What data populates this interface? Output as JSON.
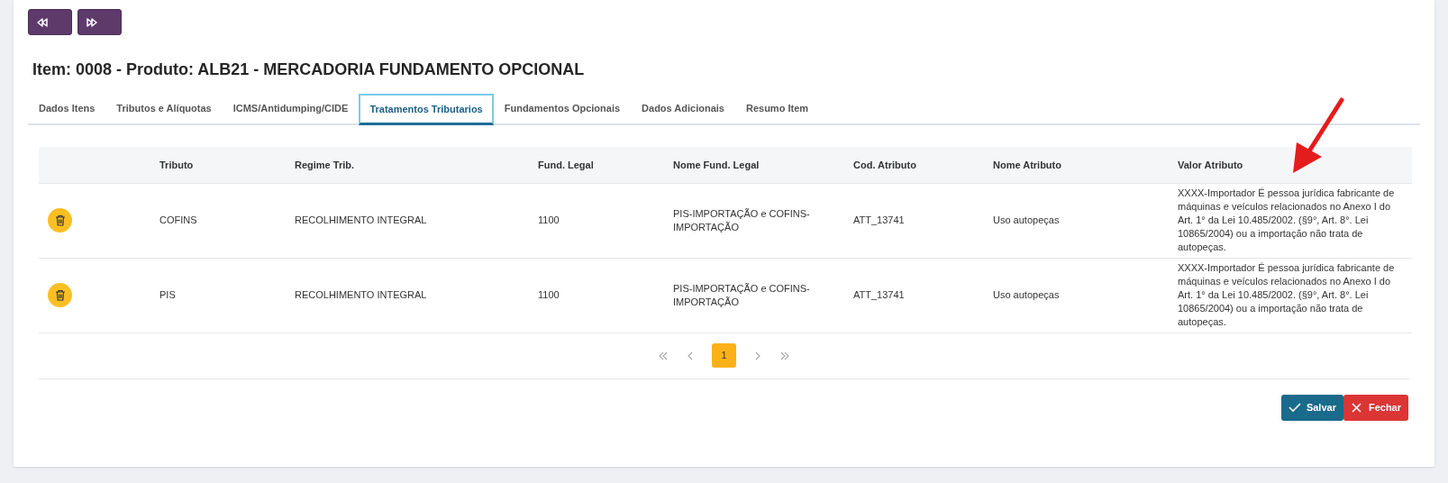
{
  "nav_buttons": [
    {
      "kind": "previous"
    },
    {
      "kind": "next"
    }
  ],
  "title": "Item: 0008 - Produto: ALB21 - MERCADORIA FUNDAMENTO OPCIONAL",
  "tabs": [
    {
      "label": "Dados Itens",
      "selected": false
    },
    {
      "label": "Tributos e Alíquotas",
      "selected": false
    },
    {
      "label": "ICMS/Antidumping/CIDE",
      "selected": false
    },
    {
      "label": "Tratamentos Tributarios",
      "selected": true
    },
    {
      "label": "Fundamentos Opcionais",
      "selected": false
    },
    {
      "label": "Dados Adicionais",
      "selected": false
    },
    {
      "label": "Resumo Item",
      "selected": false
    }
  ],
  "table": {
    "columns": [
      "Tributo",
      "Regime Trib.",
      "Fund. Legal",
      "Nome Fund. Legal",
      "Cod. Atributo",
      "Nome Atributo",
      "Valor Atributo"
    ],
    "rows": [
      {
        "cells": [
          "COFINS",
          "RECOLHIMENTO INTEGRAL",
          "1100",
          "PIS-IMPORTAÇÃO e COFINS-IMPORTAÇÃO",
          "ATT_13741",
          "Uso autopeças",
          "XXXX-Importador É pessoa jurídica fabricante de máquinas e veículos relacionados no Anexo I do Art. 1° da Lei 10.485/2002. (§9°, Art. 8°. Lei 10865/2004) ou a importação não trata de autopeças."
        ]
      },
      {
        "cells": [
          "PIS",
          "RECOLHIMENTO INTEGRAL",
          "1100",
          "PIS-IMPORTAÇÃO e COFINS-IMPORTAÇÃO",
          "ATT_13741",
          "Uso autopeças",
          "XXXX-Importador É pessoa jurídica fabricante de máquinas e veículos relacionados no Anexo I do Art. 1° da Lei 10.485/2002. (§9°, Art. 8°. Lei 10865/2004) ou a importação não trata de autopeças."
        ]
      }
    ]
  },
  "pagination": {
    "pages": [
      {
        "label": "1",
        "selected": true
      }
    ]
  },
  "actions": [
    {
      "label": "Salvar",
      "kind": "save"
    },
    {
      "label": "Fechar",
      "kind": "close"
    }
  ]
}
